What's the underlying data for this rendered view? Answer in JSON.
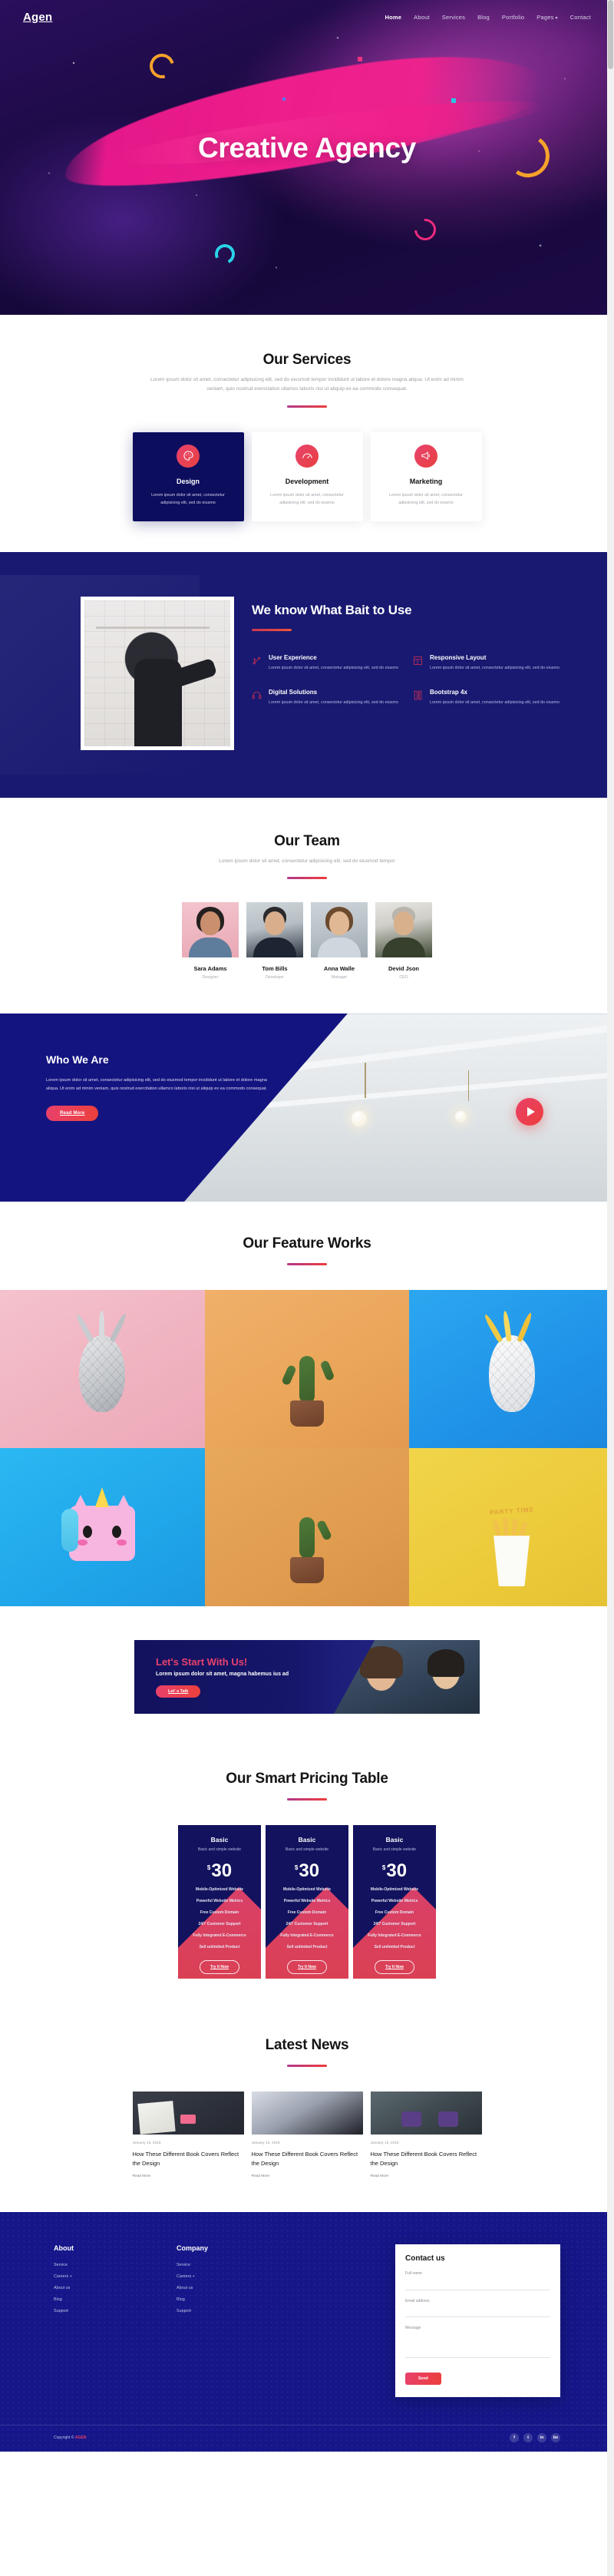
{
  "nav": {
    "logo": "Agen",
    "links": [
      {
        "label": "Home",
        "active": true
      },
      {
        "label": "About",
        "active": false
      },
      {
        "label": "Services",
        "active": false
      },
      {
        "label": "Blog",
        "active": false
      },
      {
        "label": "Portfolio",
        "active": false
      },
      {
        "label": "Pages",
        "active": false,
        "caret": "▾"
      },
      {
        "label": "Contact",
        "active": false
      }
    ]
  },
  "hero": {
    "title": "Creative Agency"
  },
  "services": {
    "title": "Our Services",
    "subtitle": "Lorem ipsum dolor sit amet, consectetur adipisicing elit, sed do eiusmod tempor incididunt ut labore et dolore magna aliqua. Ut enim ad minim veniam, quis nostrud exercitation ullamco laboris nisi ut aliquip ex ea commodo consequat.",
    "cards": [
      {
        "icon": "palette-icon",
        "name": "Design",
        "text": "Lorem ipsum dolor sit amet, consectetur adipisicing elit, sed do eiusmo"
      },
      {
        "icon": "speedometer-icon",
        "name": "Development",
        "text": "Lorem ipsum dolor sit amet, consectetur adipisicing elit, sed do eiusmo"
      },
      {
        "icon": "megaphone-icon",
        "name": "Marketing",
        "text": "Lorem ipsum dolor sit amet, consectetur adipisicing elit, sed do eiusmo"
      }
    ]
  },
  "bait": {
    "title": "We know What Bait to Use",
    "items": [
      {
        "icon": "node-path-icon",
        "heading": "User Experience",
        "text": "Lorem ipsum dolor sit amet, consectetur adipisicing elit, sed do eiusmo"
      },
      {
        "icon": "layout-grid-icon",
        "heading": "Responsive Layout",
        "text": "Lorem ipsum dolor sit amet, consectetur adipisicing elit, sed do eiusmo"
      },
      {
        "icon": "headset-icon",
        "heading": "Digital Solutions",
        "text": "Lorem ipsum dolor sit amet, consectetur adipisicing elit, sed do eiusmo"
      },
      {
        "icon": "ruler-icon",
        "heading": "Bootstrap 4x",
        "text": "Lorem ipsum dolor sit amet, consectetur adipisicing elit, sed do eiusmo"
      }
    ]
  },
  "team": {
    "title": "Our Team",
    "subtitle": "Lorem ipsum dolor sit amet, consectetur adipisicing elit, sed do eiusmod tempor",
    "members": [
      {
        "name": "Sara Adams",
        "role": "Designer"
      },
      {
        "name": "Tom Bills",
        "role": "Developer"
      },
      {
        "name": "Anna Walle",
        "role": "Manager"
      },
      {
        "name": "Devid Json",
        "role": "CEO"
      }
    ]
  },
  "who": {
    "title": "Who We Are",
    "text": "Lorem ipsum dolor sit amet, consectetur adipisicing elit, sed do eiusmod tempor incididunt ut labore et dolore magna aliqua. Ut enim ad minim veniam, quis nostrud exercitation ullamco laboris nisi ut aliquip ex ea commodo consequat.",
    "button": "Read More",
    "play_icon": "play-button-icon"
  },
  "works": {
    "title": "Our Feature Works",
    "cup_label": "PARTY TIME"
  },
  "cta": {
    "title": "Let's Start With Us!",
    "subtitle": "Lorem ipsum dolor sit amet, magna habemus ius ad",
    "button": "Let' s Talk"
  },
  "pricing": {
    "title": "Our Smart Pricing Table",
    "plans": [
      {
        "name": "Basic",
        "desc": "Basic and simple website",
        "currency": "$",
        "price": "30",
        "features": [
          "Mobile-Optimized Website",
          "Powerful Website Metrics",
          "Free Custom Domain",
          "24/7 Customer Support",
          "Fully Integrated E-Commerce",
          "Sell unlimited Product"
        ],
        "button": "Try It Now"
      },
      {
        "name": "Basic",
        "desc": "Basic and simple website",
        "currency": "$",
        "price": "30",
        "features": [
          "Mobile-Optimized Website",
          "Powerful Website Metrics",
          "Free Custom Domain",
          "24/7 Customer Support",
          "Fully Integrated E-Commerce",
          "Sell unlimited Product"
        ],
        "button": "Try It Now"
      },
      {
        "name": "Basic",
        "desc": "Basic and simple website",
        "currency": "$",
        "price": "30",
        "features": [
          "Mobile-Optimized Website",
          "Powerful Website Metrics",
          "Free Custom Domain",
          "24/7 Customer Support",
          "Fully Integrated E-Commerce",
          "Sell unlimited Product"
        ],
        "button": "Try It Now"
      }
    ]
  },
  "news": {
    "title": "Latest News",
    "posts": [
      {
        "date": "January 15, 2018",
        "title": "How These Different Book Covers Reflect the Design",
        "more": "Read More"
      },
      {
        "date": "January 15, 2018",
        "title": "How These Different Book Covers Reflect the Design",
        "more": "Read More"
      },
      {
        "date": "January 15, 2018",
        "title": "How These Different Book Covers Reflect the Design",
        "more": "Read More"
      }
    ]
  },
  "footer": {
    "columns": [
      {
        "heading": "About",
        "links": [
          "Service",
          "Careers +",
          "About us",
          "Blog",
          "Support"
        ]
      },
      {
        "heading": "Company",
        "links": [
          "Service",
          "Careers +",
          "About us",
          "Blog",
          "Support"
        ]
      }
    ],
    "contact": {
      "title": "Contact us",
      "name_label": "Full name",
      "email_label": "Email address",
      "message_label": "Message",
      "button": "Send"
    },
    "copyright": "Copyright © ",
    "copyright_brand": "AGEN",
    "socials": [
      "f",
      "t",
      "in",
      "be"
    ]
  },
  "colors": {
    "brand_navy": "#12125e",
    "accent_pink": "#ec198c",
    "accent_red": "#ec3f3b",
    "footer_blue": "#16168a"
  }
}
